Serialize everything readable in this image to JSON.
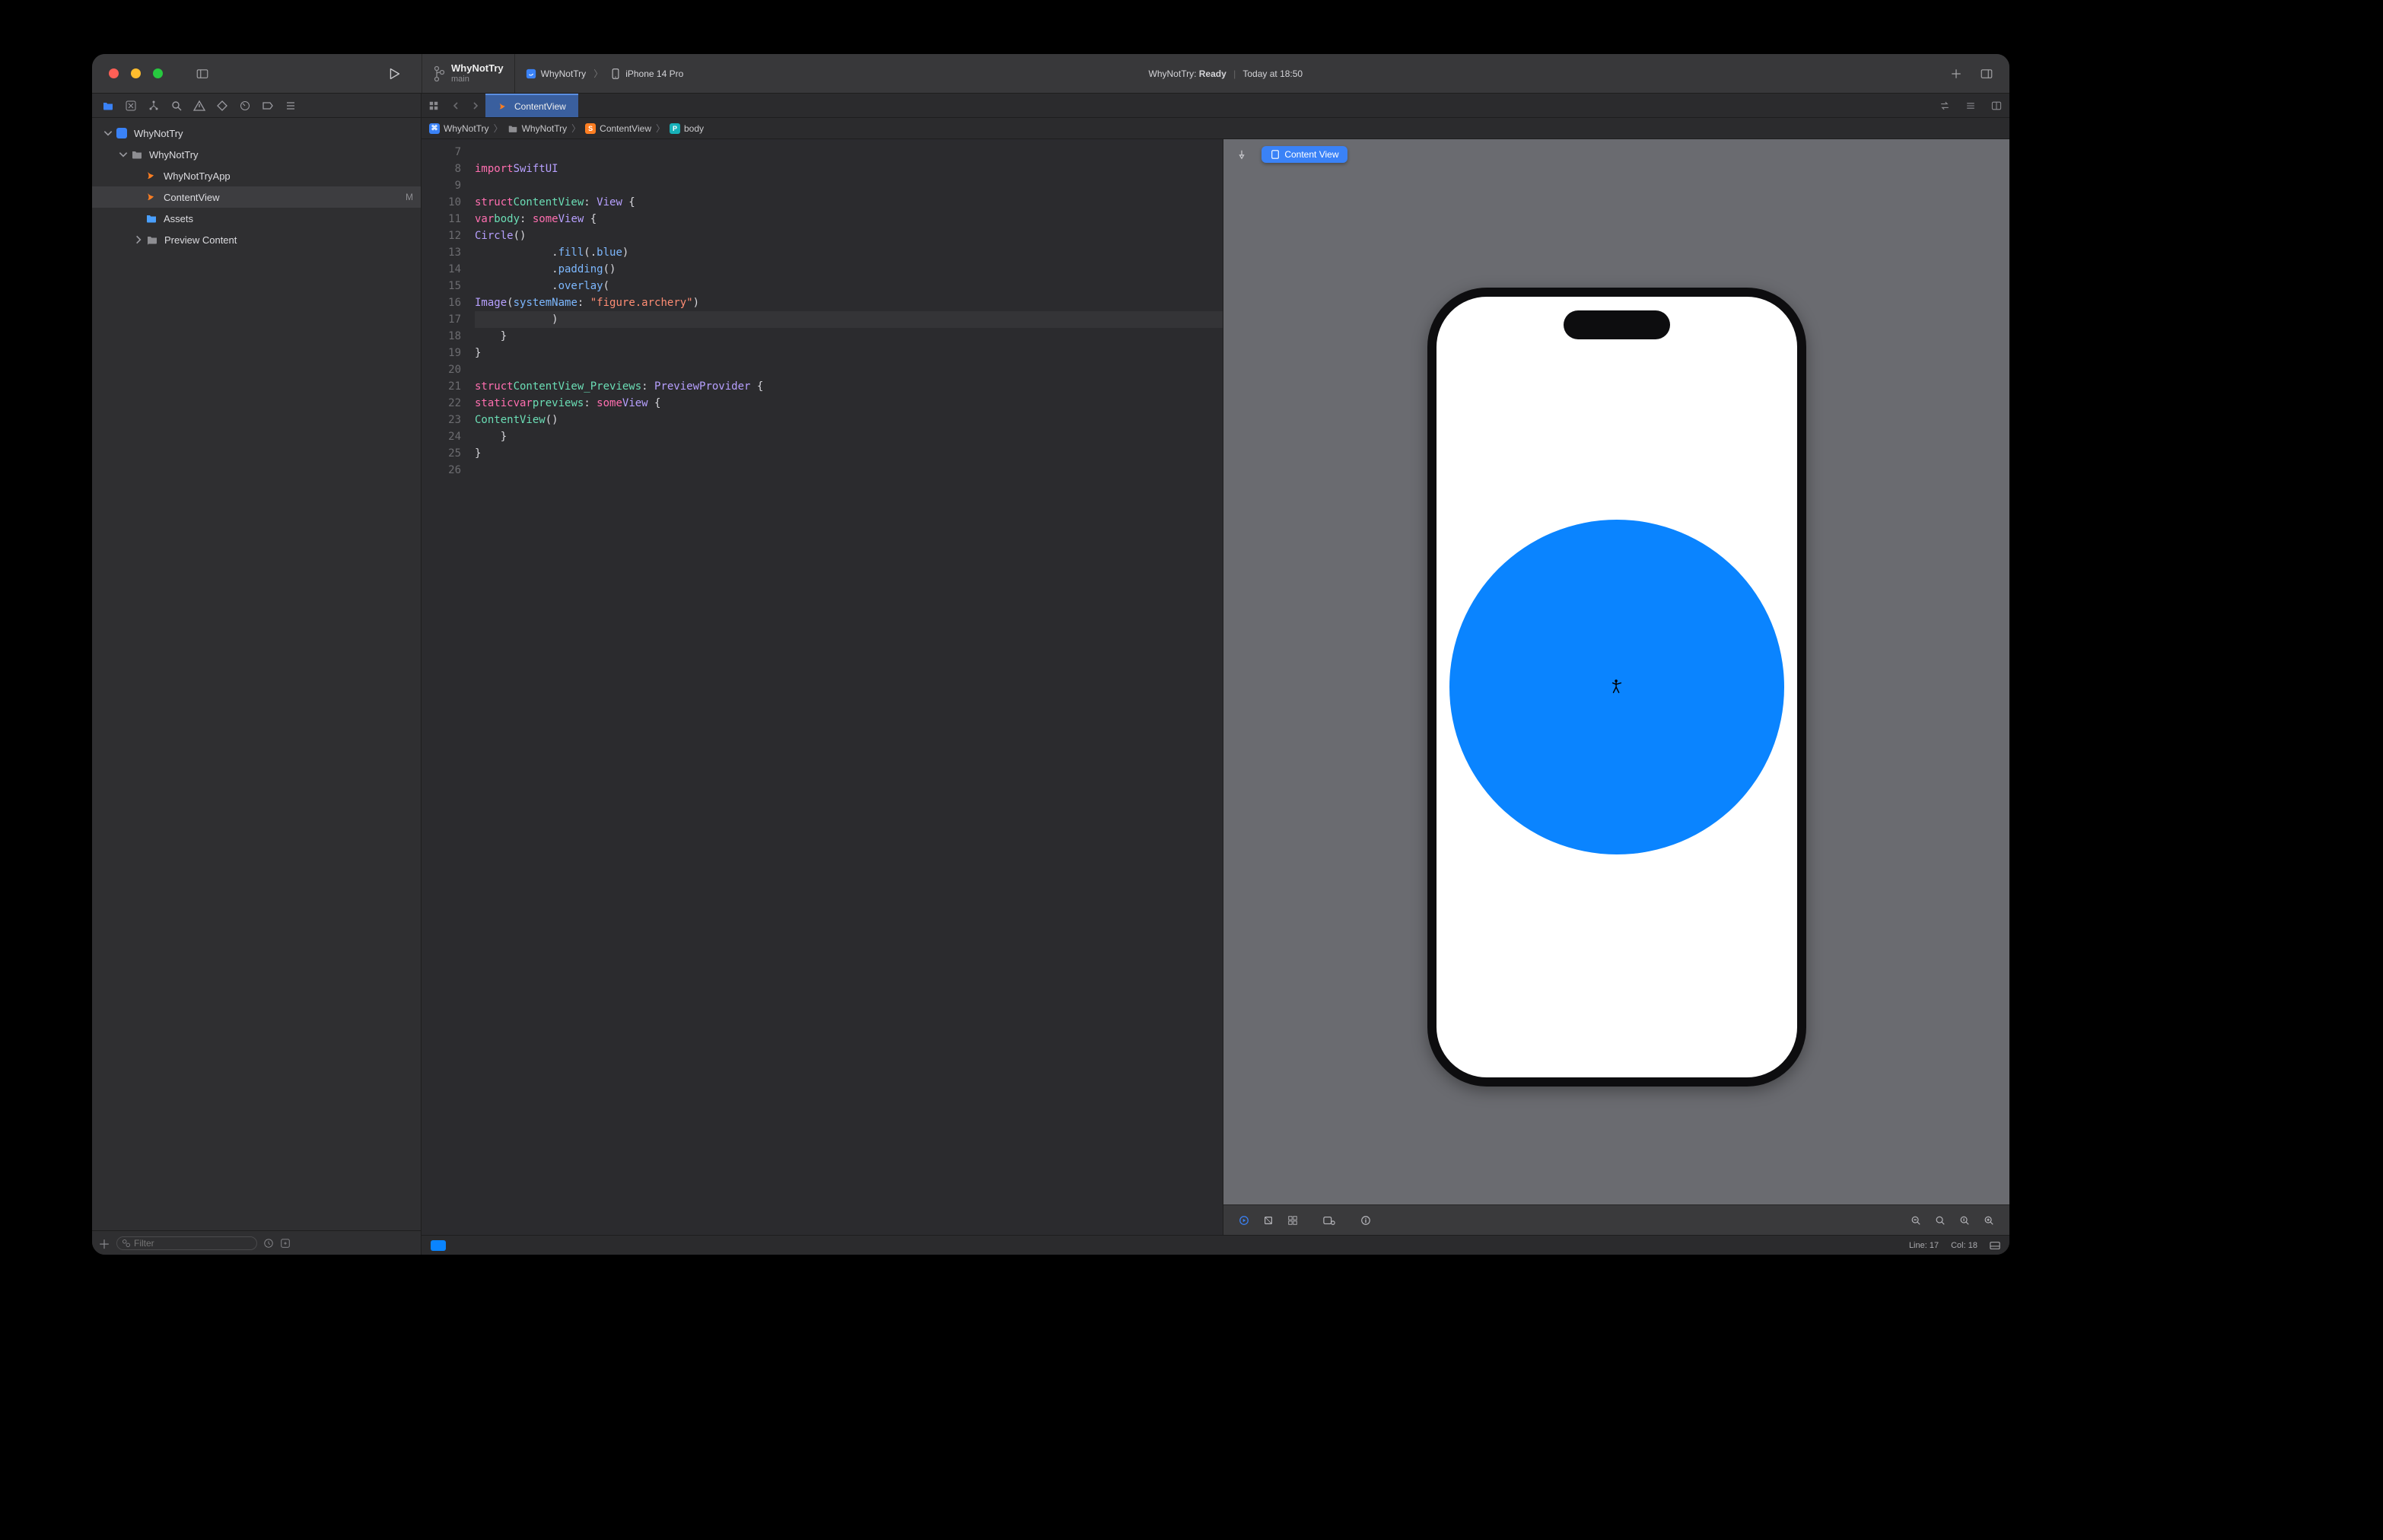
{
  "titlebar": {
    "project_name": "WhyNotTry",
    "branch": "main",
    "scheme": "WhyNotTry",
    "device": "iPhone 14 Pro",
    "status_app": "WhyNotTry:",
    "status_state": "Ready",
    "status_time": "Today at 18:50"
  },
  "navigator": {
    "tree": {
      "root": "WhyNotTry",
      "group": "WhyNotTry",
      "app_file": "WhyNotTryApp",
      "content_view": "ContentView",
      "content_view_status": "M",
      "assets": "Assets",
      "preview_content": "Preview Content"
    },
    "filter_placeholder": "Filter"
  },
  "tabs": {
    "active_file": "ContentView"
  },
  "jumpbar": {
    "c1": "WhyNotTry",
    "c2": "WhyNotTry",
    "c3": "ContentView",
    "c4": "body"
  },
  "code": {
    "lines": [
      {
        "n": 7,
        "t": ""
      },
      {
        "n": 8,
        "t": "import SwiftUI"
      },
      {
        "n": 9,
        "t": ""
      },
      {
        "n": 10,
        "t": "struct ContentView: View {"
      },
      {
        "n": 11,
        "t": "    var body: some View {"
      },
      {
        "n": 12,
        "t": "        Circle()"
      },
      {
        "n": 13,
        "t": "            .fill(.blue)"
      },
      {
        "n": 14,
        "t": "            .padding()"
      },
      {
        "n": 15,
        "t": "            .overlay("
      },
      {
        "n": 16,
        "t": "                Image(systemName: \"figure.archery\")"
      },
      {
        "n": 17,
        "t": "            )"
      },
      {
        "n": 18,
        "t": "    }"
      },
      {
        "n": 19,
        "t": "}"
      },
      {
        "n": 20,
        "t": ""
      },
      {
        "n": 21,
        "t": "struct ContentView_Previews: PreviewProvider {"
      },
      {
        "n": 22,
        "t": "    static var previews: some View {"
      },
      {
        "n": 23,
        "t": "        ContentView()"
      },
      {
        "n": 24,
        "t": "    }"
      },
      {
        "n": 25,
        "t": "}"
      },
      {
        "n": 26,
        "t": ""
      }
    ]
  },
  "canvas": {
    "chip_label": "Content View"
  },
  "status": {
    "line_label": "Line:",
    "line": "17",
    "col_label": "Col:",
    "col": "18"
  }
}
